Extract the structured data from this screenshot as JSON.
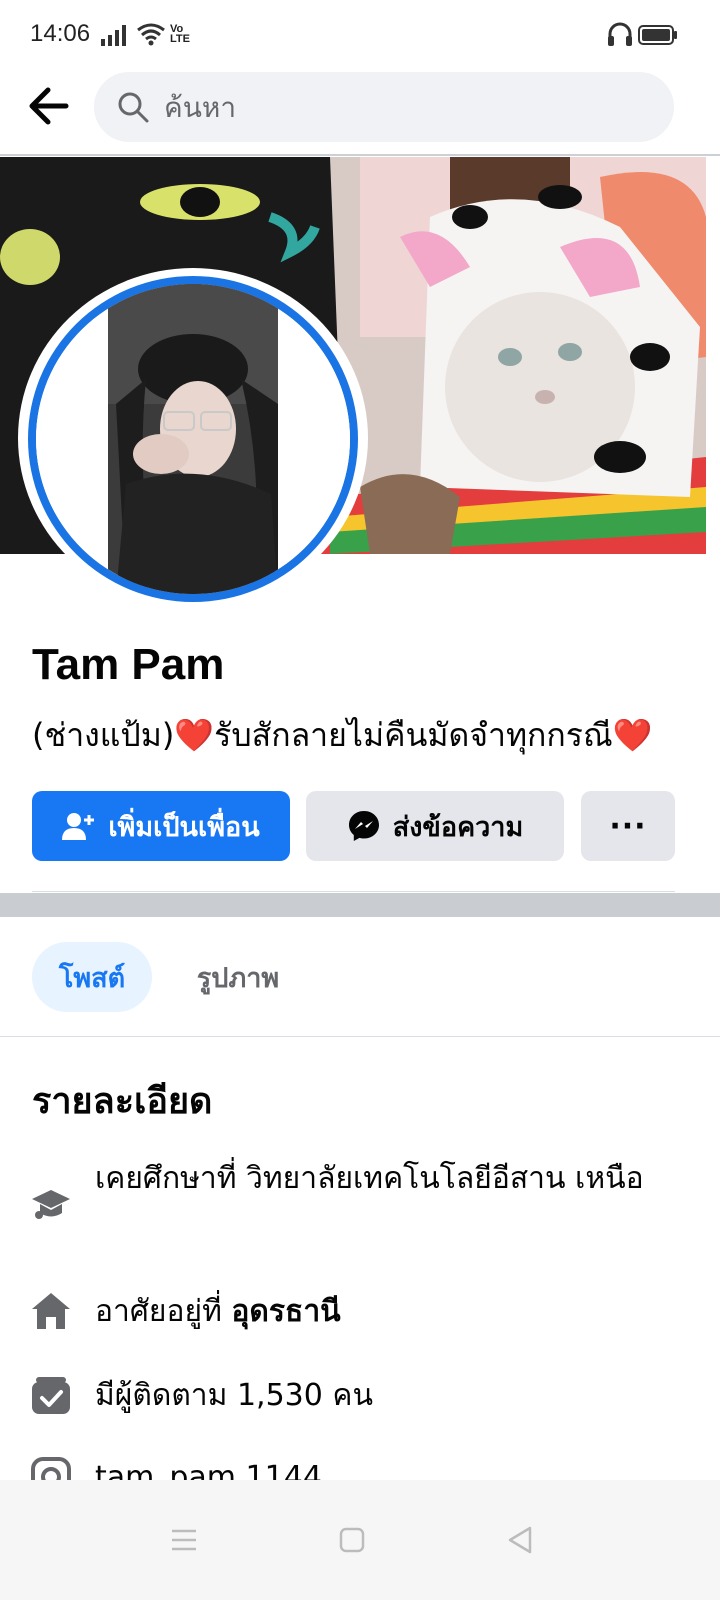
{
  "status_bar": {
    "time": "14:06",
    "network_label": "Vo LTE",
    "icons": [
      "signal-icon",
      "wifi-icon",
      "headphones-icon",
      "battery-icon"
    ]
  },
  "header": {
    "back_icon": "arrow-left-icon",
    "search_placeholder": "ค้นหา"
  },
  "profile": {
    "name": "Tam Pam",
    "bio_prefix": "(ช่างแป้ม)",
    "bio_heart": "❤️",
    "bio_main": "รับสักลายไม่คืนมัดจำทุกกรณี",
    "bio_heart_end": "❤️"
  },
  "actions": {
    "add_friend": "เพิ่มเป็นเพื่อน",
    "message": "ส่งข้อความ",
    "more": "···"
  },
  "tabs": {
    "posts": "โพสต์",
    "photos": "รูปภาพ"
  },
  "details": {
    "title": "รายละเอียด",
    "education": "เคยศึกษาที่ วิทยาลัยเทคโนโลยีอีสาน เหนือ",
    "lives_prefix": "อาศัยอยู่ที่ ",
    "lives_place": "อุดรธานี",
    "followers": "มีผู้ติดตาม 1,530 คน",
    "instagram": "tam_pam.1144"
  },
  "colors": {
    "accent": "#1877f2",
    "ring": "#1b74e4",
    "grey_button": "#e4e6eb",
    "tab_active_bg": "#e7f3ff"
  }
}
